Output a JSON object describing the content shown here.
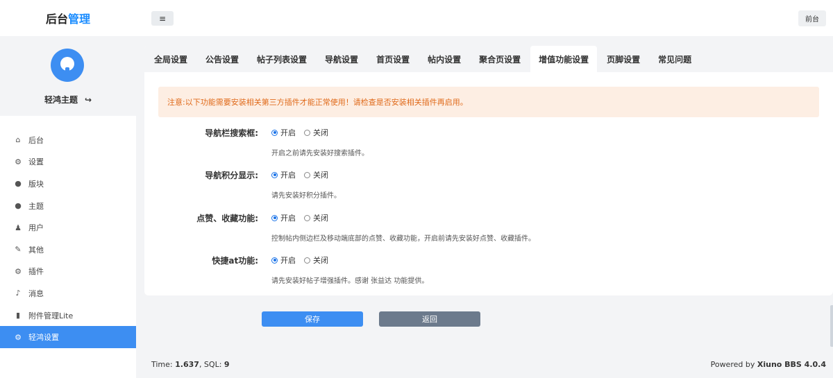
{
  "header": {
    "brand_prefix": "后台",
    "brand_accent": "管理",
    "menu_toggle": "≡",
    "front_link": "前台"
  },
  "profile": {
    "name": "轻鸿主题",
    "logout_icon": "↪"
  },
  "sidebar": {
    "items": [
      {
        "label": "后台",
        "icon": "home-icon",
        "glyph": "⌂",
        "active": false
      },
      {
        "label": "设置",
        "icon": "gear-icon",
        "glyph": "⚙",
        "active": false
      },
      {
        "label": "版块",
        "icon": "comment-icon",
        "glyph": "●",
        "active": false
      },
      {
        "label": "主题",
        "icon": "comment-icon",
        "glyph": "●",
        "active": false
      },
      {
        "label": "用户",
        "icon": "user-icon",
        "glyph": "♟",
        "active": false
      },
      {
        "label": "其他",
        "icon": "wrench-icon",
        "glyph": "✎",
        "active": false
      },
      {
        "label": "插件",
        "icon": "cogs-icon",
        "glyph": "⚙",
        "active": false
      },
      {
        "label": "消息",
        "icon": "bell-icon",
        "glyph": "♪",
        "active": false
      },
      {
        "label": "附件管理Lite",
        "icon": "file-icon",
        "glyph": "▮",
        "active": false
      },
      {
        "label": "轻鸿设置",
        "icon": "gear-icon",
        "glyph": "⚙",
        "active": true
      }
    ]
  },
  "tabs": [
    {
      "label": "全局设置",
      "active": false
    },
    {
      "label": "公告设置",
      "active": false
    },
    {
      "label": "帖子列表设置",
      "active": false
    },
    {
      "label": "导航设置",
      "active": false
    },
    {
      "label": "首页设置",
      "active": false
    },
    {
      "label": "帖内设置",
      "active": false
    },
    {
      "label": "聚合页设置",
      "active": false
    },
    {
      "label": "增值功能设置",
      "active": true
    },
    {
      "label": "页脚设置",
      "active": false
    },
    {
      "label": "常见问题",
      "active": false
    }
  ],
  "notice": "注意:以下功能需要安装相关第三方插件才能正常使用！请检查是否安装相关插件再启用。",
  "options": {
    "on": "开启",
    "off": "关闭"
  },
  "settings": [
    {
      "label": "导航栏搜索框:",
      "value": "on",
      "hint": "开启之前请先安装好搜索插件。"
    },
    {
      "label": "导航积分显示:",
      "value": "on",
      "hint": "请先安装好积分插件。"
    },
    {
      "label": "点赞、收藏功能:",
      "value": "on",
      "hint": "控制帖内侧边栏及移动端底部的点赞、收藏功能，开启前请先安装好点赞、收藏插件。"
    },
    {
      "label": "快捷at功能:",
      "value": "on",
      "hint": "请先安装好帖子增强插件。感谢 张益达 功能提供。"
    }
  ],
  "buttons": {
    "save": "保存",
    "back": "返回"
  },
  "footer": {
    "time_label": "Time:",
    "time_value": "1.637",
    "sql_label": ", SQL:",
    "sql_value": "9",
    "powered_label": "Powered by",
    "powered_value": "Xiuno BBS 4.0.4"
  }
}
